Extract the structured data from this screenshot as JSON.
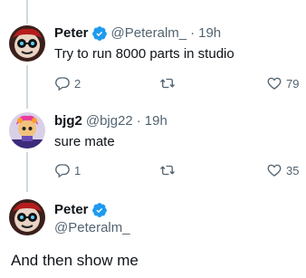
{
  "tweets": [
    {
      "name": "Peter",
      "handle": "@Peteralm_",
      "separator": "·",
      "time": "19h",
      "text": "Try to run 8000 parts in studio",
      "replies": "2",
      "retweets": "",
      "likes": "79"
    },
    {
      "name": "bjg2",
      "handle": "@bjg22",
      "separator": "·",
      "time": "19h",
      "text": "sure mate",
      "replies": "1",
      "retweets": "",
      "likes": "35"
    }
  ],
  "main_tweet": {
    "name": "Peter",
    "handle": "@Peteralm_",
    "text": "And then show me"
  },
  "colors": {
    "verified": "#1d9bf0",
    "secondary_text": "#536471",
    "thread_line": "#cfd9de"
  }
}
